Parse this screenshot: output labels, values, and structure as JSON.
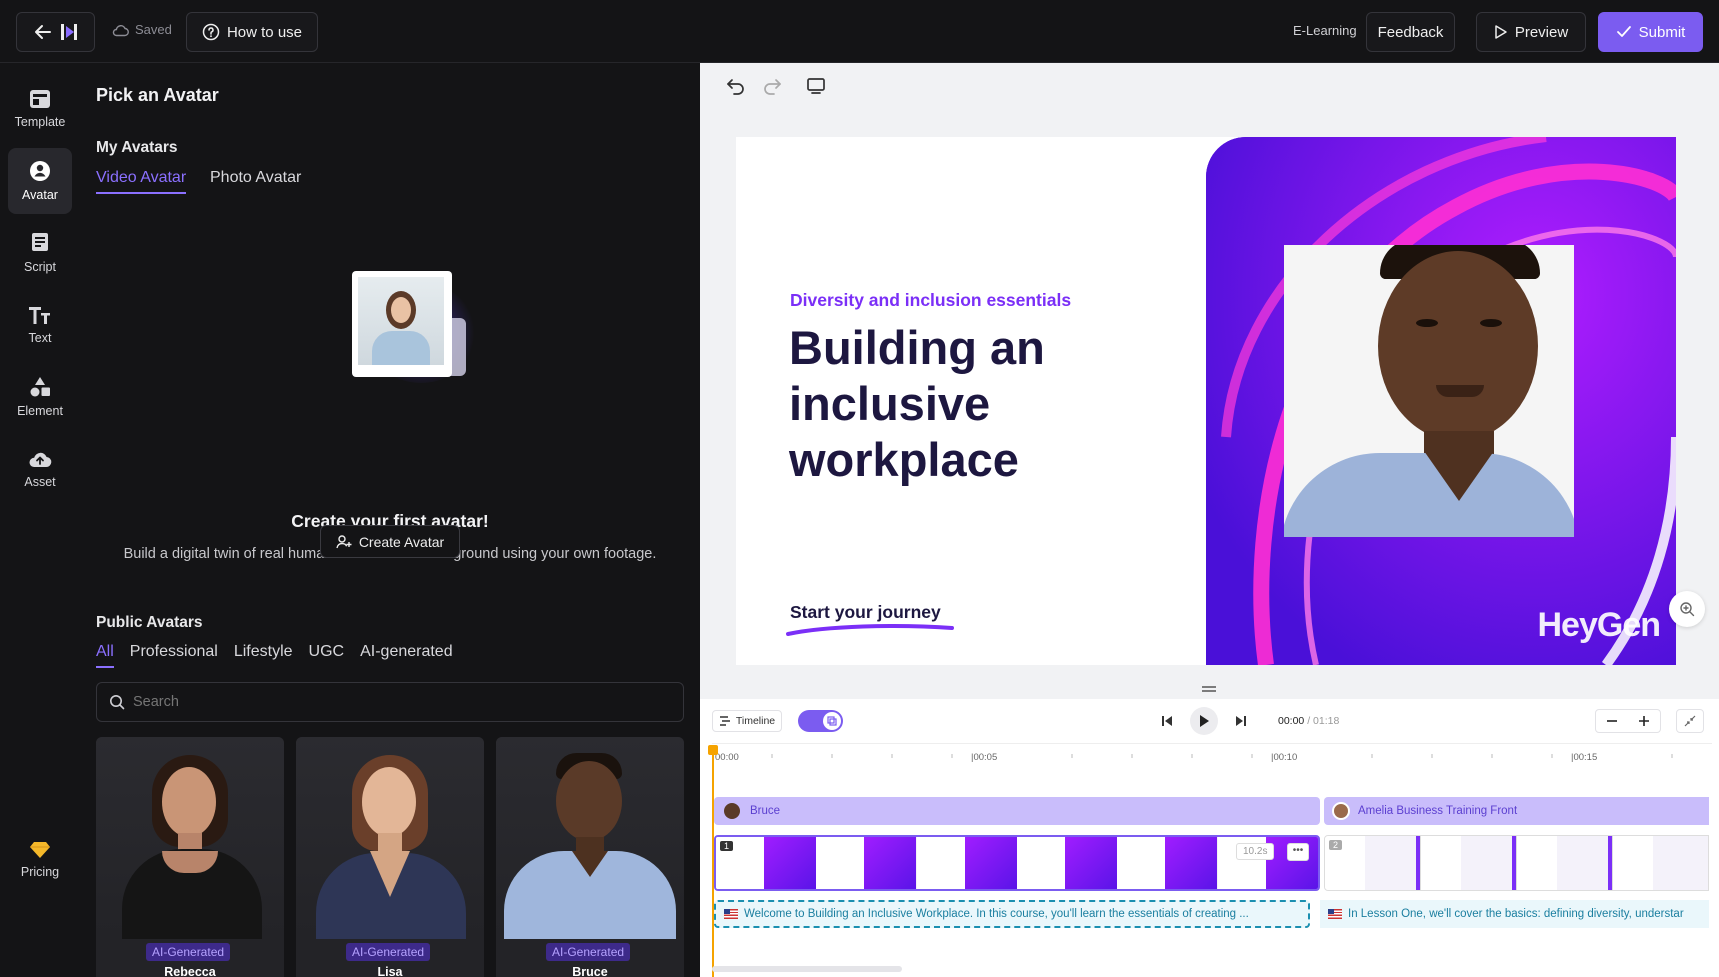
{
  "topbar": {
    "back_icon": "arrow-left-icon",
    "logo_icon": "heygen-logo-icon",
    "saved_label": "Saved",
    "how_to_use_label": "How to use",
    "project_type": "E-Learning",
    "feedback_label": "Feedback",
    "preview_label": "Preview",
    "submit_label": "Submit",
    "accent": "#7b5cf0"
  },
  "nav": {
    "items": [
      {
        "label": "Template",
        "icon": "template-icon"
      },
      {
        "label": "Avatar",
        "icon": "avatar-icon"
      },
      {
        "label": "Script",
        "icon": "script-icon"
      },
      {
        "label": "Text",
        "icon": "text-icon"
      },
      {
        "label": "Element",
        "icon": "element-icon"
      },
      {
        "label": "Asset",
        "icon": "upload-cloud-icon"
      }
    ],
    "pricing_label": "Pricing"
  },
  "panel": {
    "title": "Pick an Avatar",
    "my_avatars_heading": "My Avatars",
    "my_tabs": [
      "Video Avatar",
      "Photo Avatar"
    ],
    "empty_title": "Create your first avatar!",
    "empty_desc": "Build a digital twin of real humans with flexible background using your own footage.",
    "create_label": "Create Avatar",
    "public_heading": "Public Avatars",
    "public_tabs": [
      "All",
      "Professional",
      "Lifestyle",
      "UGC",
      "AI-generated"
    ],
    "search_placeholder": "Search",
    "cards": [
      {
        "badge": "AI-Generated",
        "name": "Rebecca"
      },
      {
        "badge": "AI-Generated",
        "name": "Lisa"
      },
      {
        "badge": "AI-Generated",
        "name": "Bruce"
      }
    ]
  },
  "slide": {
    "subtitle": "Diversity and inclusion essentials",
    "title_lines": [
      "Building an",
      "inclusive",
      "workplace"
    ],
    "cta": "Start your journey",
    "watermark": "HeyGen",
    "accent_color": "#7b2ff7"
  },
  "timeline": {
    "mode_label": "Timeline",
    "time_current": "00:00",
    "time_total": "/ 01:18",
    "ruler_labels": [
      "00:00",
      "|00:05",
      "|00:10",
      "|00:15"
    ],
    "track1_name": "Bruce",
    "track2_name": "Amelia Business Training Front",
    "scene1_index": "1",
    "scene2_index": "2",
    "scene1_duration": "10.2s",
    "script1": "Welcome to Building an Inclusive Workplace. In this course, you'll learn the essentials of creating ...",
    "script2": "In Lesson One, we'll cover the basics: defining diversity, understar"
  }
}
